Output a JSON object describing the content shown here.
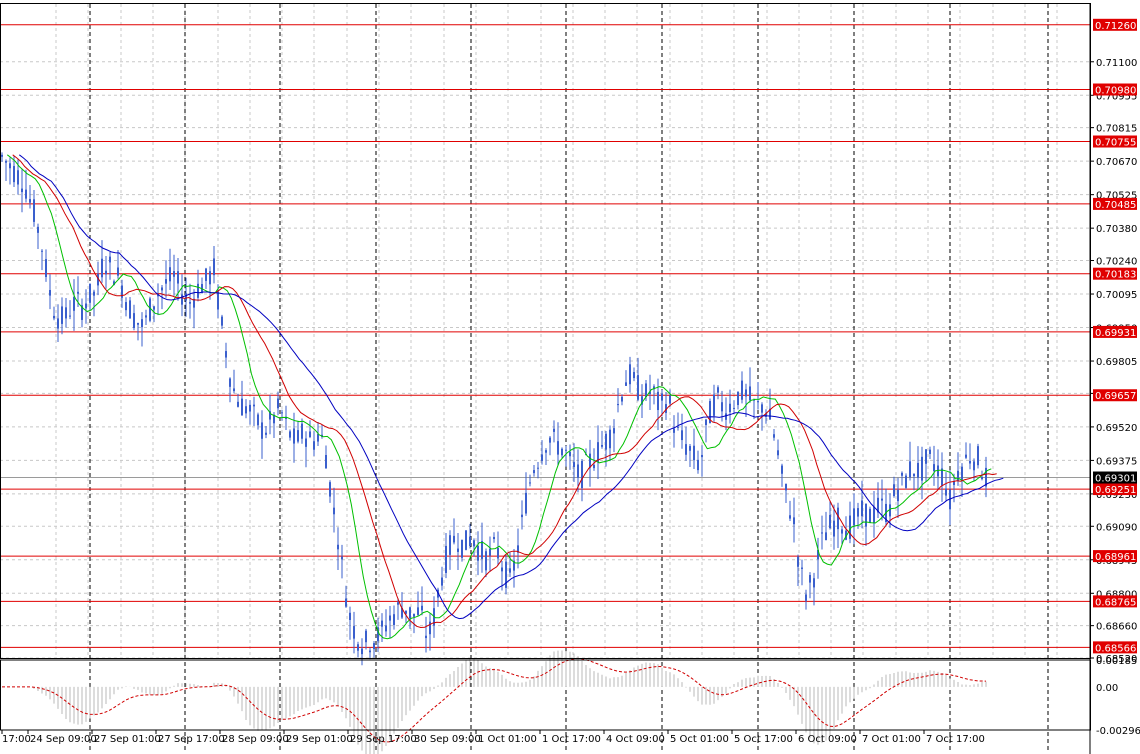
{
  "chart_data": {
    "type": "line",
    "main": {
      "ylim": [
        0.6852,
        0.7135
      ],
      "price_ticks": [
        "0.71100",
        "0.70955",
        "0.70815",
        "0.70670",
        "0.70525",
        "0.70380",
        "0.70240",
        "0.70095",
        "0.69950",
        "0.69805",
        "0.69665",
        "0.69520",
        "0.69375",
        "0.69230",
        "0.69090",
        "0.68945",
        "0.68800",
        "0.68660",
        "0.68520"
      ],
      "levels": [
        {
          "label": "0.71260",
          "value": 0.7126
        },
        {
          "label": "0.70980",
          "value": 0.7098
        },
        {
          "label": "0.70755",
          "value": 0.70755
        },
        {
          "label": "0.70485",
          "value": 0.70485
        },
        {
          "label": "0.70183",
          "value": 0.70183
        },
        {
          "label": "0.69931",
          "value": 0.69931
        },
        {
          "label": "0.69657",
          "value": 0.69657
        },
        {
          "label": "0.69251",
          "value": 0.69251
        },
        {
          "label": "0.68961",
          "value": 0.68961
        },
        {
          "label": "0.68765",
          "value": 0.68765
        },
        {
          "label": "0.68566",
          "value": 0.68566
        }
      ],
      "current_price": {
        "label": "0.69301",
        "value": 0.69301
      },
      "price_path": [
        [
          0,
          0.707
        ],
        [
          8,
          0.7066
        ],
        [
          16,
          0.7062
        ],
        [
          24,
          0.7058
        ],
        [
          30,
          0.705
        ],
        [
          36,
          0.7042
        ],
        [
          42,
          0.703
        ],
        [
          48,
          0.7015
        ],
        [
          52,
          0.7005
        ],
        [
          58,
          0.7
        ],
        [
          64,
          0.6998
        ],
        [
          70,
          0.7003
        ],
        [
          76,
          0.7006
        ],
        [
          82,
          0.7004
        ],
        [
          88,
          0.7008
        ],
        [
          96,
          0.701
        ],
        [
          104,
          0.7025
        ],
        [
          112,
          0.702
        ],
        [
          120,
          0.7016
        ],
        [
          128,
          0.7005
        ],
        [
          136,
          0.6998
        ],
        [
          144,
          0.6995
        ],
        [
          150,
          0.7003
        ],
        [
          158,
          0.701
        ],
        [
          166,
          0.7014
        ],
        [
          174,
          0.7017
        ],
        [
          182,
          0.701
        ],
        [
          190,
          0.7006
        ],
        [
          198,
          0.7012
        ],
        [
          206,
          0.7015
        ],
        [
          214,
          0.702
        ],
        [
          220,
          0.7
        ],
        [
          226,
          0.6985
        ],
        [
          232,
          0.697
        ],
        [
          240,
          0.6962
        ],
        [
          248,
          0.696
        ],
        [
          256,
          0.6955
        ],
        [
          264,
          0.695
        ],
        [
          272,
          0.6955
        ],
        [
          280,
          0.696
        ],
        [
          288,
          0.695
        ],
        [
          296,
          0.6945
        ],
        [
          304,
          0.695
        ],
        [
          312,
          0.6945
        ],
        [
          320,
          0.695
        ],
        [
          326,
          0.694
        ],
        [
          332,
          0.692
        ],
        [
          338,
          0.6905
        ],
        [
          344,
          0.6885
        ],
        [
          350,
          0.687
        ],
        [
          356,
          0.6862
        ],
        [
          364,
          0.6858
        ],
        [
          372,
          0.686
        ],
        [
          380,
          0.6862
        ],
        [
          388,
          0.6868
        ],
        [
          396,
          0.6872
        ],
        [
          404,
          0.6875
        ],
        [
          412,
          0.687
        ],
        [
          420,
          0.6872
        ],
        [
          428,
          0.686
        ],
        [
          434,
          0.687
        ],
        [
          440,
          0.6885
        ],
        [
          448,
          0.6898
        ],
        [
          456,
          0.6905
        ],
        [
          464,
          0.69
        ],
        [
          472,
          0.6905
        ],
        [
          480,
          0.6898
        ],
        [
          488,
          0.6895
        ],
        [
          496,
          0.69
        ],
        [
          504,
          0.689
        ],
        [
          510,
          0.6885
        ],
        [
          516,
          0.6895
        ],
        [
          522,
          0.691
        ],
        [
          528,
          0.6925
        ],
        [
          534,
          0.6935
        ],
        [
          540,
          0.694
        ],
        [
          548,
          0.6948
        ],
        [
          556,
          0.6945
        ],
        [
          564,
          0.6942
        ],
        [
          572,
          0.6935
        ],
        [
          580,
          0.693
        ],
        [
          588,
          0.6936
        ],
        [
          596,
          0.694
        ],
        [
          604,
          0.6945
        ],
        [
          612,
          0.695
        ],
        [
          620,
          0.6965
        ],
        [
          628,
          0.6975
        ],
        [
          636,
          0.697
        ],
        [
          644,
          0.6965
        ],
        [
          652,
          0.6968
        ],
        [
          660,
          0.696
        ],
        [
          668,
          0.6965
        ],
        [
          676,
          0.695
        ],
        [
          684,
          0.6945
        ],
        [
          692,
          0.694
        ],
        [
          700,
          0.6935
        ],
        [
          708,
          0.6955
        ],
        [
          716,
          0.6965
        ],
        [
          724,
          0.696
        ],
        [
          732,
          0.6962
        ],
        [
          740,
          0.6967
        ],
        [
          748,
          0.6965
        ],
        [
          756,
          0.696
        ],
        [
          764,
          0.6962
        ],
        [
          770,
          0.6955
        ],
        [
          776,
          0.6945
        ],
        [
          782,
          0.693
        ],
        [
          788,
          0.692
        ],
        [
          794,
          0.691
        ],
        [
          800,
          0.689
        ],
        [
          806,
          0.688
        ],
        [
          812,
          0.6885
        ],
        [
          818,
          0.6895
        ],
        [
          824,
          0.6905
        ],
        [
          832,
          0.691
        ],
        [
          840,
          0.6912
        ],
        [
          848,
          0.6908
        ],
        [
          856,
          0.6912
        ],
        [
          864,
          0.6915
        ],
        [
          872,
          0.6913
        ],
        [
          880,
          0.6918
        ],
        [
          888,
          0.6915
        ],
        [
          896,
          0.6925
        ],
        [
          904,
          0.6928
        ],
        [
          912,
          0.6935
        ],
        [
          920,
          0.6932
        ],
        [
          928,
          0.6938
        ],
        [
          936,
          0.6935
        ],
        [
          944,
          0.693
        ],
        [
          950,
          0.692
        ],
        [
          956,
          0.6932
        ],
        [
          962,
          0.6935
        ],
        [
          970,
          0.694
        ],
        [
          978,
          0.6938
        ],
        [
          986,
          0.693
        ]
      ],
      "ma_green_color": "#00c000",
      "ma_red_color": "#d00000",
      "ma_blue_color": "#0000c0",
      "candle_color": "#3a5fcd",
      "level_color": "#e00000",
      "current_color": "#000000"
    },
    "oscillator": {
      "ticks": [
        "0.00185",
        "0.00",
        "-0.00296"
      ],
      "ylim": [
        -0.00296,
        0.00185
      ],
      "zero_label_value": 0
    },
    "x_axis": {
      "ticks": [
        "17:00",
        "24 Sep 09:00",
        "27 Sep 01:00",
        "27 Sep 17:00",
        "28 Sep 09:00",
        "29 Sep 01:00",
        "29 Sep 17:00",
        "30 Sep 09:00",
        "1 Oct 01:00",
        "1 Oct 17:00",
        "4 Oct 09:00",
        "5 Oct 01:00",
        "5 Oct 17:00",
        "6 Oct 09:00",
        "7 Oct 01:00",
        "7 Oct 17:00"
      ]
    }
  }
}
